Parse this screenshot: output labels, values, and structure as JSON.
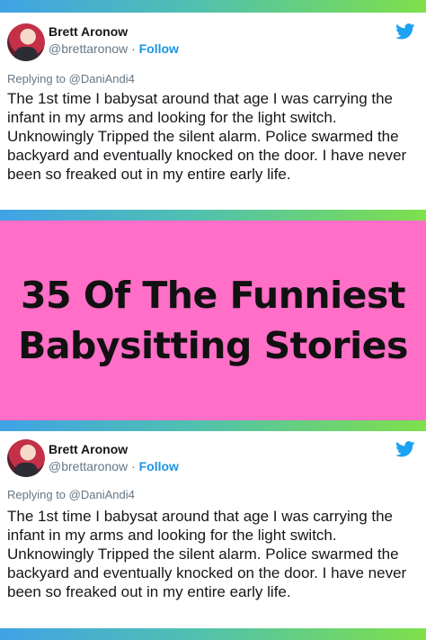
{
  "colors": {
    "banner_background": "#ff6ec7",
    "follow_link": "#1b95e0",
    "twitter_brand": "#1da1f2"
  },
  "tweet_top": {
    "author_name": "Brett Aronow",
    "handle": "@brettaronow",
    "separator": "·",
    "follow_label": "Follow",
    "replying_to": "Replying to @DaniAndi4",
    "text": "The 1st time I babysat around that age I was carrying the infant in my arms and looking for the light switch. Unknowingly Tripped the silent alarm. Police swarmed the backyard and eventually knocked on the door. I have never been so freaked out in my entire early life.",
    "icon": "twitter-bird-icon"
  },
  "banner": {
    "line1": "35 Of The Funniest",
    "line2": "Babysitting Stories"
  },
  "tweet_bottom": {
    "author_name": "Brett Aronow",
    "handle": "@brettaronow",
    "separator": "·",
    "follow_label": "Follow",
    "replying_to": "Replying to @DaniAndi4",
    "text": "The 1st time I babysat around that age I was carrying the infant in my arms and looking for the light switch. Unknowingly Tripped the silent alarm. Police swarmed the backyard and eventually knocked on the door. I have never been so freaked out in my entire early life.",
    "icon": "twitter-bird-icon"
  }
}
